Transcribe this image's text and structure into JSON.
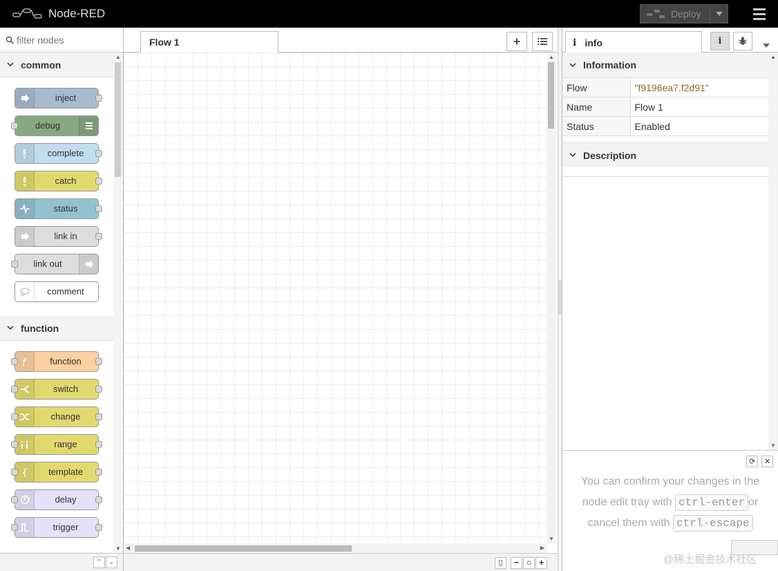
{
  "header": {
    "title": "Node-RED",
    "deploy_label": "Deploy"
  },
  "palette": {
    "search_placeholder": "filter nodes",
    "categories": [
      {
        "title": "common",
        "nodes": [
          {
            "label": "inject",
            "color": "#a6bbcf",
            "icon": "arrow-in-icon",
            "in": false,
            "out": true,
            "icon_right": false
          },
          {
            "label": "debug",
            "color": "#87a980",
            "icon": "list-icon",
            "in": true,
            "out": false,
            "icon_right": true
          },
          {
            "label": "complete",
            "color": "#c0deed",
            "icon": "exclamation-icon",
            "in": false,
            "out": true,
            "icon_right": false
          },
          {
            "label": "catch",
            "color": "#e2d96e",
            "icon": "exclamation-icon",
            "in": false,
            "out": true,
            "icon_right": false
          },
          {
            "label": "status",
            "color": "#94c1d0",
            "icon": "pulse-icon",
            "in": false,
            "out": true,
            "icon_right": false
          },
          {
            "label": "link in",
            "color": "#dddddd",
            "icon": "link-in-icon",
            "in": false,
            "out": true,
            "icon_right": false
          },
          {
            "label": "link out",
            "color": "#dddddd",
            "icon": "link-out-icon",
            "in": true,
            "out": false,
            "icon_right": true
          },
          {
            "label": "comment",
            "color": "#ffffff",
            "icon": "comment-icon",
            "in": false,
            "out": false,
            "icon_right": false
          }
        ]
      },
      {
        "title": "function",
        "nodes": [
          {
            "label": "function",
            "color": "#fdd0a2",
            "icon": "function-icon",
            "in": true,
            "out": true,
            "icon_right": false
          },
          {
            "label": "switch",
            "color": "#e2d96e",
            "icon": "switch-icon",
            "in": true,
            "out": true,
            "icon_right": false
          },
          {
            "label": "change",
            "color": "#e2d96e",
            "icon": "shuffle-icon",
            "in": true,
            "out": true,
            "icon_right": false
          },
          {
            "label": "range",
            "color": "#e2d96e",
            "icon": "range-icon",
            "in": true,
            "out": true,
            "icon_right": false
          },
          {
            "label": "template",
            "color": "#e2d96e",
            "icon": "brace-icon",
            "in": true,
            "out": true,
            "icon_right": false
          },
          {
            "label": "delay",
            "color": "#e6e0f8",
            "icon": "timer-icon",
            "in": true,
            "out": true,
            "icon_right": false
          },
          {
            "label": "trigger",
            "color": "#e6e0f8",
            "icon": "trigger-icon",
            "in": true,
            "out": true,
            "icon_right": false
          }
        ]
      }
    ]
  },
  "workspace": {
    "tab_label": "Flow 1"
  },
  "sidebar": {
    "tab_label": "info",
    "info_section_title": "Information",
    "rows": [
      {
        "key": "Flow",
        "value": "\"f9196ea7.f2d91\""
      },
      {
        "key": "Name",
        "value": "Flow 1"
      },
      {
        "key": "Status",
        "value": "Enabled"
      }
    ],
    "description_title": "Description",
    "tray": {
      "line1": "You can confirm your changes in the",
      "line2a": "node edit tray with",
      "key1": "ctrl-enter",
      "line2b": "or",
      "line3a": "cancel them with",
      "key2": "ctrl-escape"
    }
  },
  "watermark": "@稀土掘金技术社区"
}
